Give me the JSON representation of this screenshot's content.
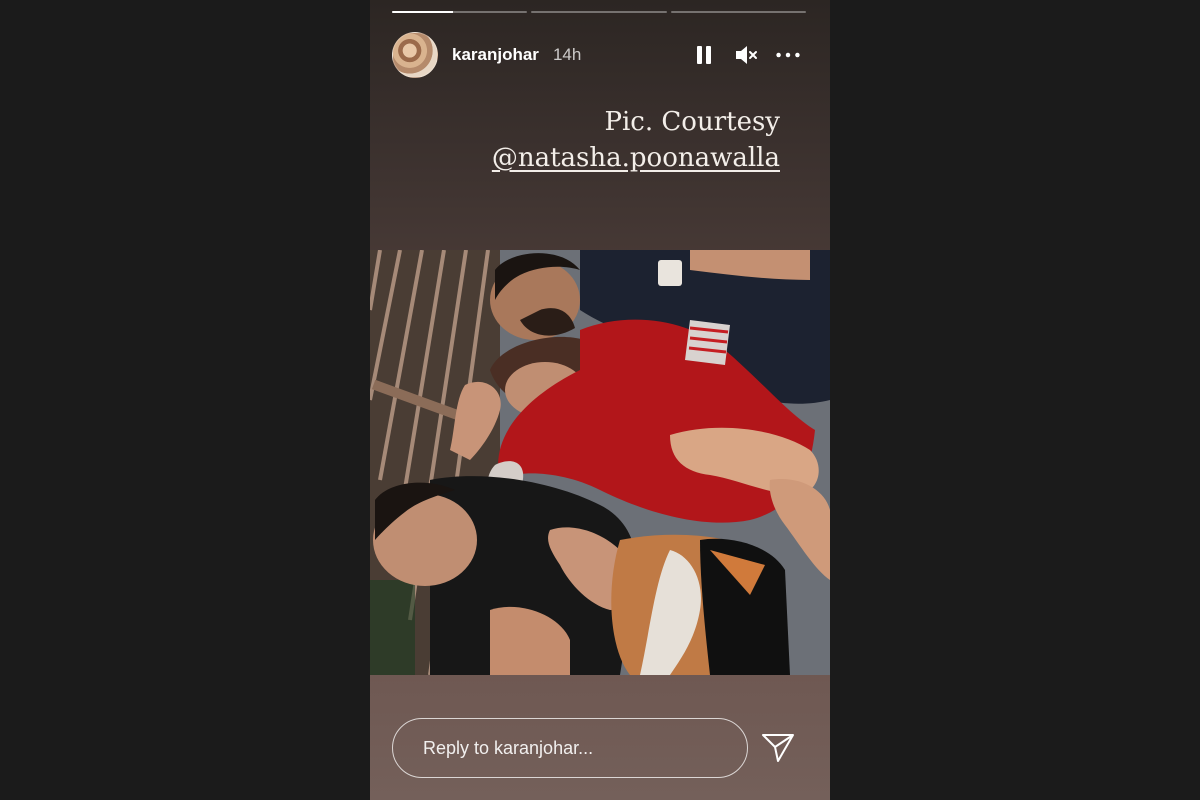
{
  "story": {
    "progress": [
      0.45,
      0,
      0
    ],
    "author": {
      "username": "karanjohar",
      "time_ago": "14h"
    },
    "controls": {
      "pause_icon": "pause-icon",
      "mute_icon": "muted-speaker-icon",
      "more_icon": "more-horizontal-icon"
    },
    "caption": {
      "line1": "Pic. Courtesy",
      "mention": "@natasha.poonawalla"
    },
    "reply": {
      "placeholder": "Reply to karanjohar...",
      "send_icon": "send-paper-plane-icon"
    }
  }
}
